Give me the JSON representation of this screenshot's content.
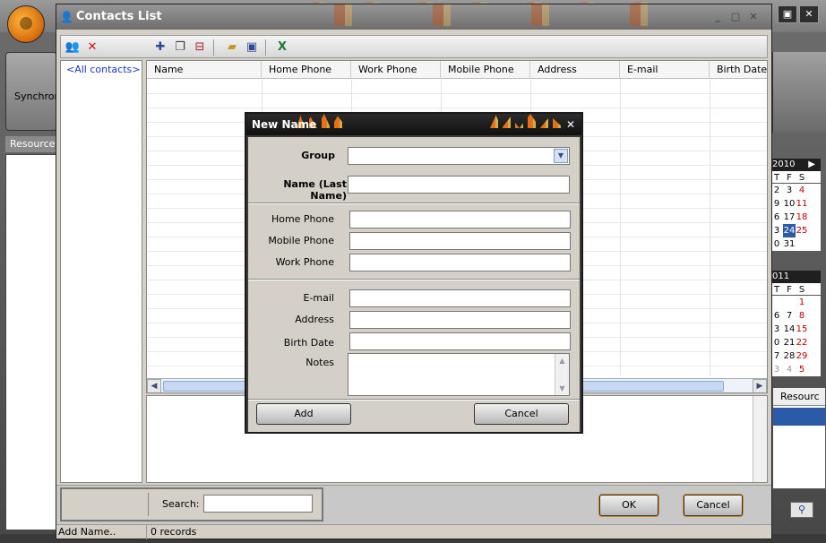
{
  "background_app": {
    "sync_label": "Synchron",
    "resources_header": "Resources",
    "resource_column_header": "Resourc",
    "calendars": [
      {
        "header": "2010",
        "dow": [
          "T",
          "F",
          "S"
        ],
        "rows": [
          [
            {
              "t": "2"
            },
            {
              "t": "3"
            },
            {
              "t": "4",
              "red": true
            }
          ],
          [
            {
              "t": "9"
            },
            {
              "t": "10"
            },
            {
              "t": "11",
              "red": true
            }
          ],
          [
            {
              "t": "6"
            },
            {
              "t": "17"
            },
            {
              "t": "18",
              "red": true
            }
          ],
          [
            {
              "t": "3"
            },
            {
              "t": "24",
              "sel": true
            },
            {
              "t": "25",
              "red": true
            }
          ],
          [
            {
              "t": "0"
            },
            {
              "t": "31"
            },
            {
              "t": ""
            }
          ]
        ]
      },
      {
        "header": "011",
        "dow": [
          "T",
          "F",
          "S"
        ],
        "rows": [
          [
            {
              "t": ""
            },
            {
              "t": ""
            },
            {
              "t": "1",
              "red": true
            }
          ],
          [
            {
              "t": "6"
            },
            {
              "t": "7"
            },
            {
              "t": "8",
              "red": true
            }
          ],
          [
            {
              "t": "3"
            },
            {
              "t": "14"
            },
            {
              "t": "15",
              "red": true
            }
          ],
          [
            {
              "t": "0"
            },
            {
              "t": "21"
            },
            {
              "t": "22",
              "red": true
            }
          ],
          [
            {
              "t": "7"
            },
            {
              "t": "28"
            },
            {
              "t": "29",
              "red": true
            }
          ],
          [
            {
              "t": "3",
              "gray": true
            },
            {
              "t": "4",
              "gray": true
            },
            {
              "t": "5",
              "red": true
            }
          ]
        ]
      }
    ]
  },
  "contacts_window": {
    "title": "Contacts List",
    "tree_root": "<All contacts>",
    "columns": [
      "Name",
      "Home Phone",
      "Work Phone",
      "Mobile Phone",
      "Address",
      "E-mail",
      "Birth Date"
    ],
    "search_label": "Search:",
    "search_value": "",
    "ok_label": "OK",
    "cancel_label": "Cancel",
    "status_left": "Add Name..",
    "status_right": "0 records"
  },
  "new_name_dialog": {
    "title": "New Name",
    "fields": {
      "group": {
        "label": "Group",
        "value": ""
      },
      "name": {
        "label": "Name (Last Name)",
        "value": ""
      },
      "home_phone": {
        "label": "Home Phone",
        "value": ""
      },
      "mobile_phone": {
        "label": "Mobile Phone",
        "value": ""
      },
      "work_phone": {
        "label": "Work Phone",
        "value": ""
      },
      "email": {
        "label": "E-mail",
        "value": ""
      },
      "address": {
        "label": "Address",
        "value": ""
      },
      "birth_date": {
        "label": "Birth Date",
        "value": ""
      },
      "notes": {
        "label": "Notes",
        "value": ""
      }
    },
    "add_label": "Add",
    "cancel_label": "Cancel"
  },
  "colors": {
    "accent_selection": "#2b5aa8",
    "weekend_red": "#c00000",
    "link_blue": "#1d35c6"
  }
}
